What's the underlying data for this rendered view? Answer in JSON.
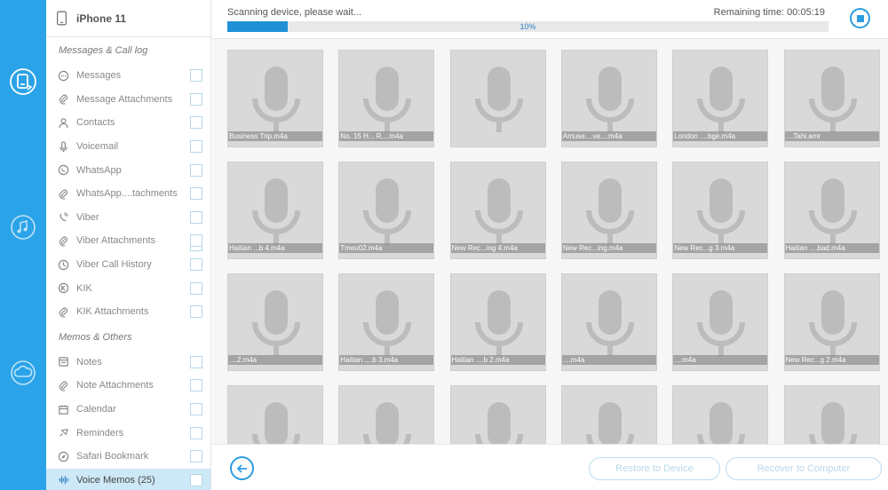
{
  "rail": {
    "items": [
      {
        "icon": "device-recover-icon"
      },
      {
        "icon": "itunes-recover-icon"
      },
      {
        "icon": "icloud-recover-icon"
      }
    ]
  },
  "sidebar": {
    "device_name": "iPhone 11",
    "groups": [
      {
        "title": "Messages & Call log",
        "items": [
          {
            "label": "Messages",
            "icon": "chat-icon"
          },
          {
            "label": "Message Attachments",
            "icon": "paperclip-icon"
          },
          {
            "label": "Contacts",
            "icon": "person-icon"
          },
          {
            "label": "Voicemail",
            "icon": "microphone-icon"
          },
          {
            "label": "WhatsApp",
            "icon": "whatsapp-icon"
          },
          {
            "label": "WhatsApp....tachments",
            "icon": "paperclip-icon"
          },
          {
            "label": "Viber",
            "icon": "viber-icon"
          },
          {
            "label": "Viber Attachments",
            "icon": "paperclip-icon"
          },
          {
            "label": "Viber Call History",
            "icon": "clock-icon"
          },
          {
            "label": "KIK",
            "icon": "kik-icon"
          },
          {
            "label": "KIK Attachments",
            "icon": "paperclip-icon"
          }
        ]
      },
      {
        "title": "Memos & Others",
        "items": [
          {
            "label": "Notes",
            "icon": "notes-icon"
          },
          {
            "label": "Note Attachments",
            "icon": "paperclip-icon"
          },
          {
            "label": "Calendar",
            "icon": "calendar-icon"
          },
          {
            "label": "Reminders",
            "icon": "reminder-icon"
          },
          {
            "label": "Safari Bookmark",
            "icon": "compass-icon"
          },
          {
            "label": "Voice Memos (25)",
            "icon": "waveform-icon",
            "active": true
          }
        ]
      }
    ]
  },
  "scan": {
    "status": "Scanning device, please wait...",
    "remaining": "Remaining time: 00:05:19",
    "percent_label": "10%",
    "progress": 0.1
  },
  "tiles": [
    "Business Trip.m4a",
    "No. 15 H... R....m4a",
    "",
    "Amuse....ve....m4a",
    "London ....bge.m4a",
    "....Tahi.amr",
    "Haitian ...b 4.m4a",
    "Tmeu02.m4a",
    "New Rec...ing 4.m4a",
    "New Rec...ing.m4a",
    "New Rec...g 3.m4a",
    "Haitian ....bad.m4a",
    "....2.m4a",
    "Haitian ....b 3.m4a",
    "Haitian ....b 2.m4a",
    "....m4a",
    "....m4a",
    "New Rec...g 2.m4a",
    "",
    "",
    "",
    "",
    "",
    ""
  ],
  "buttons": {
    "restore": "Restore to Device",
    "recover": "Recover to Computer"
  },
  "colors": {
    "accent": "#2aa3e8",
    "progress_fill": "#1e90d6",
    "active_item": "#cde8f7"
  }
}
